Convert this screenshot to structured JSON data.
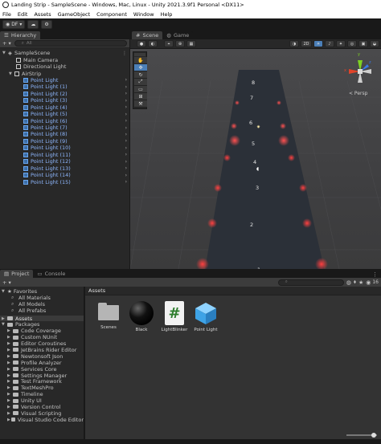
{
  "window": {
    "title": "Landing Strip - SampleScene - Windows, Mac, Linux - Unity 2021.3.9f1 Personal <DX11>"
  },
  "menu": [
    "File",
    "Edit",
    "Assets",
    "GameObject",
    "Component",
    "Window",
    "Help"
  ],
  "toolbar": {
    "account_label": "DF",
    "account_caret": "▾",
    "cloud_icon": "☁",
    "settings_icon": "⚙"
  },
  "hierarchy": {
    "tab_label": "Hierarchy",
    "add_label": "+ ▾",
    "search_placeholder": "All",
    "scene_name": "SampleScene",
    "items": [
      "Main Camera",
      "Directional Light",
      "AirStrip"
    ],
    "point_lights": [
      "Point Light",
      "Point Light (1)",
      "Point Light (2)",
      "Point Light (3)",
      "Point Light (4)",
      "Point Light (5)",
      "Point Light (6)",
      "Point Light (7)",
      "Point Light (8)",
      "Point Light (9)",
      "Point Light (10)",
      "Point Light (11)",
      "Point Light (12)",
      "Point Light (13)",
      "Point Light (14)",
      "Point Light (15)"
    ]
  },
  "scene": {
    "tabs": [
      "Scene",
      "Game"
    ],
    "view_2d": "2D",
    "persp_label": "< Persp",
    "axis_x": "x",
    "axis_y": "y",
    "axis_z": "z",
    "numbers": [
      "8",
      "7",
      "6",
      "5",
      "4",
      "3",
      "2",
      "1"
    ]
  },
  "project": {
    "tabs": [
      "Project",
      "Console"
    ],
    "add_label": "+ ▾",
    "count_label": "16",
    "favorites": {
      "label": "Favorites",
      "items": [
        "All Materials",
        "All Models",
        "All Prefabs"
      ]
    },
    "assets_label": "Assets",
    "packages": {
      "label": "Packages",
      "items": [
        "Code Coverage",
        "Custom NUnit",
        "Editor Coroutines",
        "JetBrains Rider Editor",
        "Newtonsoft Json",
        "Profile Analyzer",
        "Services Core",
        "Settings Manager",
        "Test Framework",
        "TextMeshPro",
        "Timeline",
        "Unity UI",
        "Version Control",
        "Visual Scripting",
        "Visual Studio Code Editor"
      ]
    },
    "breadcrumb": "Assets",
    "asset_items": [
      {
        "name": "Scenes",
        "icon": "folder-icon"
      },
      {
        "name": "Black",
        "icon": "material-sphere-icon"
      },
      {
        "name": "LightBlinker",
        "icon": "csharp-script-icon"
      },
      {
        "name": "Point Light",
        "icon": "prefab-cube-icon"
      }
    ],
    "script_glyph": "#"
  },
  "colors": {
    "accent": "#4b7fb8",
    "light_red": "#ff2a2a",
    "runway": "#2b3038"
  }
}
